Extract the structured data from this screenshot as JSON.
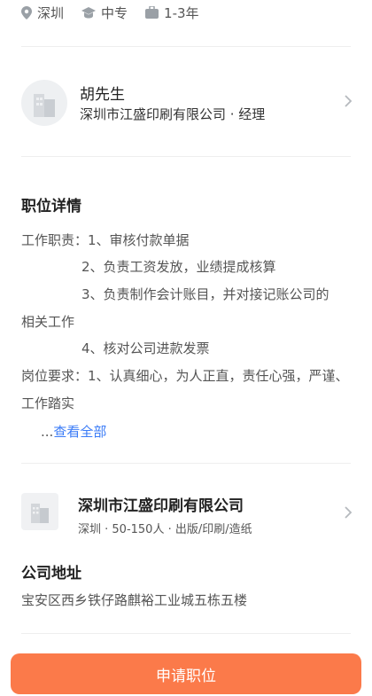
{
  "meta": {
    "city": "深圳",
    "education": "中专",
    "experience": "1-3年"
  },
  "recruiter": {
    "name": "胡先生",
    "company_title": "深圳市江盛印刷有限公司 · 经理"
  },
  "details": {
    "title": "职位详情",
    "lines": [
      "工作职责：1、审核付款单据",
      "2、负责工资发放，业绩提成核算",
      "3、负责制作会计账目，并对接记账公司的",
      "相关工作",
      "4、核对公司进款发票",
      "岗位要求：1、认真细心，为人正直，责任心强，严谨、",
      "工作踏实"
    ],
    "more_prefix": "...",
    "more_link": "查看全部"
  },
  "company": {
    "name": "深圳市江盛印刷有限公司",
    "info": "深圳 · 50-150人 · 出版/印刷/造纸"
  },
  "address": {
    "title": "公司地址",
    "value": "宝安区西乡铁仔路麒裕工业城五栋五楼"
  },
  "actions": {
    "apply": "申请职位"
  },
  "colors": {
    "accent": "#fb7a4a",
    "link": "#3a7bf7"
  }
}
